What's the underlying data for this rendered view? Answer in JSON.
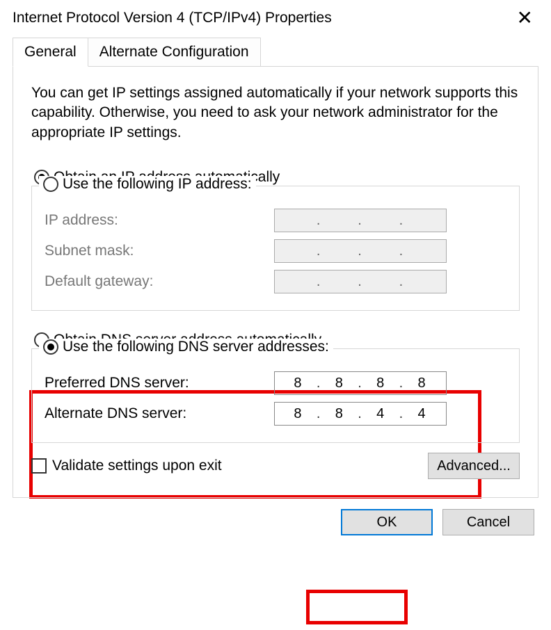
{
  "window": {
    "title": "Internet Protocol Version 4 (TCP/IPv4) Properties"
  },
  "tabs": {
    "general": "General",
    "alternate": "Alternate Configuration"
  },
  "description": "You can get IP settings assigned automatically if your network supports this capability. Otherwise, you need to ask your network administrator for the appropriate IP settings.",
  "ip_group": {
    "auto_label": "Obtain an IP address automatically",
    "manual_label": "Use the following IP address:",
    "ip_label": "IP address:",
    "subnet_label": "Subnet mask:",
    "gateway_label": "Default gateway:"
  },
  "dns_group": {
    "auto_label": "Obtain DNS server address automatically",
    "manual_label": "Use the following DNS server addresses:",
    "preferred_label": "Preferred DNS server:",
    "alternate_label": "Alternate DNS server:",
    "preferred_value": {
      "a": "8",
      "b": "8",
      "c": "8",
      "d": "8"
    },
    "alternate_value": {
      "a": "8",
      "b": "8",
      "c": "4",
      "d": "4"
    }
  },
  "validate_label": "Validate settings upon exit",
  "buttons": {
    "advanced": "Advanced...",
    "ok": "OK",
    "cancel": "Cancel"
  }
}
